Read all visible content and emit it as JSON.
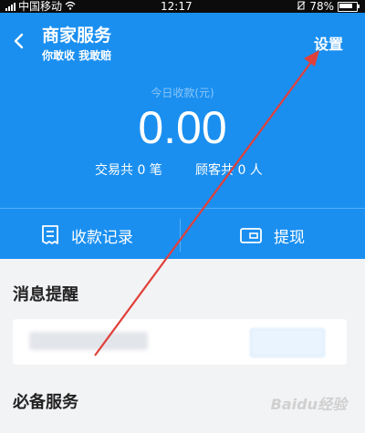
{
  "status_bar": {
    "carrier": "中国移动",
    "time": "12:17",
    "battery": "78%"
  },
  "header": {
    "title": "商家服务",
    "subtitle": "你敢收 我敢赔",
    "settings_label": "设置",
    "today_label": "今日收款(元)",
    "amount": "0.00",
    "trades": "交易共 0 笔",
    "customers": "顾客共 0 人",
    "background_color": "#1a8ff0"
  },
  "actions": {
    "records_label": "收款记录",
    "withdraw_label": "提现"
  },
  "sections": {
    "messages_title": "消息提醒",
    "services_title": "必备服务"
  },
  "watermark": "Baidu经验"
}
